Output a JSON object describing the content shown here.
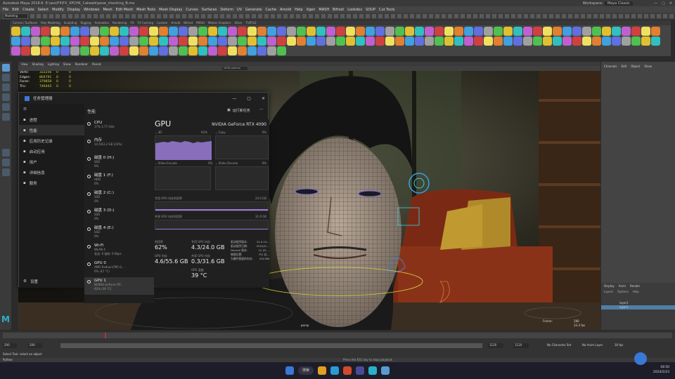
{
  "window": {
    "title": "Autodesk Maya 2018.6: E:\\ass\\FX\\FX_XPCHK_Catwalk\\pose_checking_B.ma",
    "workspace_label": "Workspace:",
    "workspace_value": "Maya Classic"
  },
  "menu": [
    "File",
    "Edit",
    "Create",
    "Select",
    "Modify",
    "Display",
    "Windows",
    "Mesh",
    "Edit Mesh",
    "Mesh Tools",
    "Mesh Display",
    "Curves",
    "Surfaces",
    "Deform",
    "UV",
    "Generate",
    "Cache",
    "Arnold",
    "Help",
    "Xgen",
    "MASH",
    "Bifrost",
    "Lookdev",
    "SOUP",
    "Cut Tools"
  ],
  "mode_select": "Modeling",
  "shelf_tabs": [
    "Curves / Surfaces",
    "Poly Modeling",
    "Sculpting",
    "Rigging",
    "Animation",
    "Rendering",
    "FX",
    "FX Caching",
    "Custom",
    "Arnold",
    "Bifrost",
    "MASH",
    "Motion Graphics",
    "XGen",
    "TURTLE"
  ],
  "viewport": {
    "menu": [
      "View",
      "Shading",
      "Lighting",
      "Show",
      "Renderer",
      "Panels"
    ],
    "stats": [
      {
        "label": "Verts:",
        "value": "322256",
        "extra": "0",
        "extra2": "0"
      },
      {
        "label": "Edges:",
        "value": "864791",
        "extra": "0",
        "extra2": "0"
      },
      {
        "label": "Faces:",
        "value": "379858",
        "extra": "0",
        "extra2": "0"
      },
      {
        "label": "Tris:",
        "value": "746443",
        "extra": "0",
        "extra2": "0"
      }
    ],
    "camera": "persp",
    "frame_label": "Frame:",
    "frame_value": "280",
    "fps": "33.3 fps",
    "gamma": "sRGB gamma"
  },
  "channel_box": {
    "tabs": [
      "Channels",
      "Edit",
      "Object",
      "Show"
    ],
    "layer_tabs": [
      "Display",
      "Anim",
      "Render"
    ],
    "layer_menu": [
      "Layers",
      "Options",
      "Help"
    ],
    "layers": [
      "layer2",
      "layer1"
    ]
  },
  "task_manager": {
    "title": "任务管理器",
    "section": "性能",
    "run_task": "运行新任务",
    "nav": [
      {
        "label": "进程",
        "icon": "grid-icon"
      },
      {
        "label": "性能",
        "icon": "performance-icon"
      },
      {
        "label": "应用历史记录",
        "icon": "history-icon"
      },
      {
        "label": "启动应用",
        "icon": "startup-icon"
      },
      {
        "label": "用户",
        "icon": "users-icon"
      },
      {
        "label": "详细信息",
        "icon": "details-icon"
      },
      {
        "label": "服务",
        "icon": "services-icon"
      }
    ],
    "settings": "设置",
    "items": [
      {
        "name": "CPU",
        "sub1": "17% 3.77 GHz",
        "sub2": ""
      },
      {
        "name": "内存",
        "sub1": "14.5/63.2 GB (23%)",
        "sub2": ""
      },
      {
        "name": "磁盘 0 (H:)",
        "sub1": "SSD",
        "sub2": "0%"
      },
      {
        "name": "磁盘 1 (F:)",
        "sub1": "HDD",
        "sub2": "0%"
      },
      {
        "name": "磁盘 2 (C:)",
        "sub1": "SSD",
        "sub2": "0%"
      },
      {
        "name": "磁盘 3 (D:)",
        "sub1": "SSD",
        "sub2": "0%"
      },
      {
        "name": "磁盘 4 (E:)",
        "sub1": "SSD",
        "sub2": "0%"
      },
      {
        "name": "Wi-Fi",
        "sub1": "WLAN 4",
        "sub2": "发送: 0 接收: 0 Kbps"
      },
      {
        "name": "GPU 0",
        "sub1": "AMD Radeon(TM) G...",
        "sub2": "0% (41 °C)"
      },
      {
        "name": "GPU 1",
        "sub1": "NVIDIA GeForce RT...",
        "sub2": "62% (39 °C)"
      }
    ],
    "gpu": {
      "heading": "GPU",
      "model": "NVIDIA GeForce RTX 4090",
      "g1_label": "3D",
      "g1_pct": "62%",
      "g2_label": "Copy",
      "g2_pct": "0%",
      "g3_label": "Video Encode",
      "g3_pct": "0%",
      "g4_label": "Video Decode",
      "g4_pct": "0%",
      "dedicated_label": "专用 GPU 内存利用率",
      "dedicated_max": "24.0 GB",
      "shared_label": "共享 GPU 内存利用率",
      "shared_max": "31.6 GB",
      "util_label": "利用率",
      "util_value": "62%",
      "ded_mem_label": "专用 GPU 内存",
      "ded_mem_value": "4.3/24.0 GB",
      "gpu_mem_label": "GPU 内存",
      "gpu_mem_value": "4.6/55.6 GB",
      "shared_mem_label": "共享 GPU 内存",
      "shared_mem_value": "0.3/31.6 GB",
      "temp_label": "GPU 温度",
      "temp_value": "39 °C",
      "info": [
        {
          "k": "驱动程序版本:",
          "v": "31.0.15..."
        },
        {
          "k": "驱动程序日期:",
          "v": "2024/1/..."
        },
        {
          "k": "DirectX 版本:",
          "v": "12 (FL..."
        },
        {
          "k": "物理位置:",
          "v": "PCI 总..."
        },
        {
          "k": "为硬件保留的内存:",
          "v": "434 MB"
        }
      ]
    }
  },
  "status": {
    "start": "200",
    "start2": "200",
    "end": "1120",
    "end2": "1120",
    "char_set": "No Character Set",
    "anim_layer": "No Anim Layer",
    "fps": "30 fps",
    "help": "Select Tool: select an object",
    "mel": "Python",
    "hint": "Press the ESC key to stop playback"
  },
  "clock": {
    "time": "18:50",
    "date": "2024/2/23"
  },
  "taskbar_search": "搜索",
  "colors": {
    "gpu_purple": "#9a7ad6",
    "maya_blue": "#5a9ad2",
    "active_layer": "#4f7fa6"
  }
}
